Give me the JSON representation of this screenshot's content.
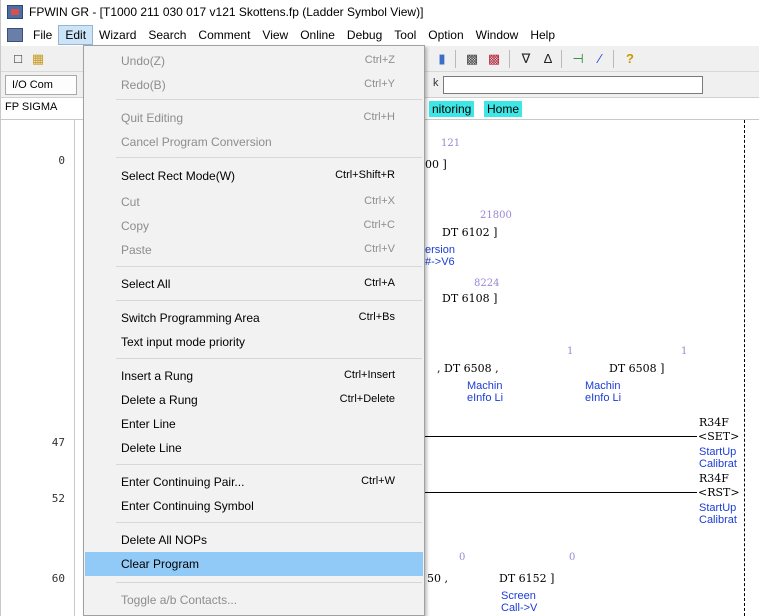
{
  "window": {
    "title": "FPWIN GR - [T1000 211 030 017 v121 Skottens.fp (Ladder Symbol View)]"
  },
  "menubar": {
    "items": [
      "File",
      "Edit",
      "Wizard",
      "Search",
      "Comment",
      "View",
      "Online",
      "Debug",
      "Tool",
      "Option",
      "Window",
      "Help"
    ],
    "active": "Edit"
  },
  "toolbar2": {
    "io_label": "I/O Com",
    "k_prefix": "k"
  },
  "tabs": {
    "sigma": "FP SIGMA",
    "monitoring": "nitoring",
    "home": "Home"
  },
  "ladder": {
    "rung_numbers": [
      "0",
      "47",
      "52",
      "60"
    ],
    "texts": {
      "n121": "121",
      "l_00": "00   ]",
      "n21800": "21800",
      "dt6102": "DT 6102   ]",
      "ersion": "ersion",
      "arrow_v6": "#->V6",
      "n8224": "8224",
      "dt6108": "DT 6108   ]",
      "one_a": "1",
      "one_b": "1",
      "dt6508_a": ",   DT 6508   ,",
      "dt6508_b": "DT 6508   ]",
      "machin_a": "Machin",
      "einfo_a": "eInfo Li",
      "machin_b": "Machin",
      "einfo_b": "eInfo Li",
      "r34f_a": "R34F",
      "set": "<SET>",
      "startup_a": "StartUp",
      "calibrat_a": "Calibrat",
      "r34f_b": "R34F",
      "rst": "<RST>",
      "startup_b": "StartUp",
      "calibrat_b": "Calibrat",
      "zero_a": "0",
      "zero_b": "0",
      "l_50": "50   ,",
      "dt6152": "DT 6152   ]",
      "screen": "Screen",
      "callv": "Call->V"
    }
  },
  "edit_menu": {
    "items": [
      {
        "label": "Undo(Z)",
        "shortcut": "Ctrl+Z",
        "disabled": true
      },
      {
        "label": "Redo(B)",
        "shortcut": "Ctrl+Y",
        "disabled": true
      },
      {
        "label": "Quit Editing",
        "shortcut": "Ctrl+H",
        "disabled": true
      },
      {
        "label": "Cancel Program Conversion",
        "shortcut": "",
        "disabled": true
      },
      {
        "label": "Select Rect Mode(W)",
        "shortcut": "Ctrl+Shift+R",
        "disabled": false
      },
      {
        "label": "Cut",
        "shortcut": "Ctrl+X",
        "disabled": true
      },
      {
        "label": "Copy",
        "shortcut": "Ctrl+C",
        "disabled": true
      },
      {
        "label": "Paste",
        "shortcut": "Ctrl+V",
        "disabled": true
      },
      {
        "label": "Select All",
        "shortcut": "Ctrl+A",
        "disabled": false
      },
      {
        "label": "Switch Programming Area",
        "shortcut": "Ctrl+Bs",
        "disabled": false
      },
      {
        "label": "Text input mode priority",
        "shortcut": "",
        "disabled": false
      },
      {
        "label": "Insert a Rung",
        "shortcut": "Ctrl+Insert",
        "disabled": false
      },
      {
        "label": "Delete a Rung",
        "shortcut": "Ctrl+Delete",
        "disabled": false
      },
      {
        "label": "Enter Line",
        "shortcut": "",
        "disabled": false
      },
      {
        "label": "Delete Line",
        "shortcut": "",
        "disabled": false
      },
      {
        "label": "Enter Continuing Pair...",
        "shortcut": "Ctrl+W",
        "disabled": false
      },
      {
        "label": "Enter Continuing Symbol",
        "shortcut": "",
        "disabled": false
      },
      {
        "label": "Delete All NOPs",
        "shortcut": "",
        "disabled": false
      },
      {
        "label": "Clear Program",
        "shortcut": "",
        "disabled": false,
        "highlighted": true
      },
      {
        "label": "Toggle a/b Contacts...",
        "shortcut": "",
        "disabled": true
      }
    ]
  },
  "colors": {
    "menu_highlight": "#91c9f7",
    "tab_cyan": "#3ee6e6",
    "comment_blue": "#1b3cd6",
    "value_purple": "#9b86d6"
  }
}
